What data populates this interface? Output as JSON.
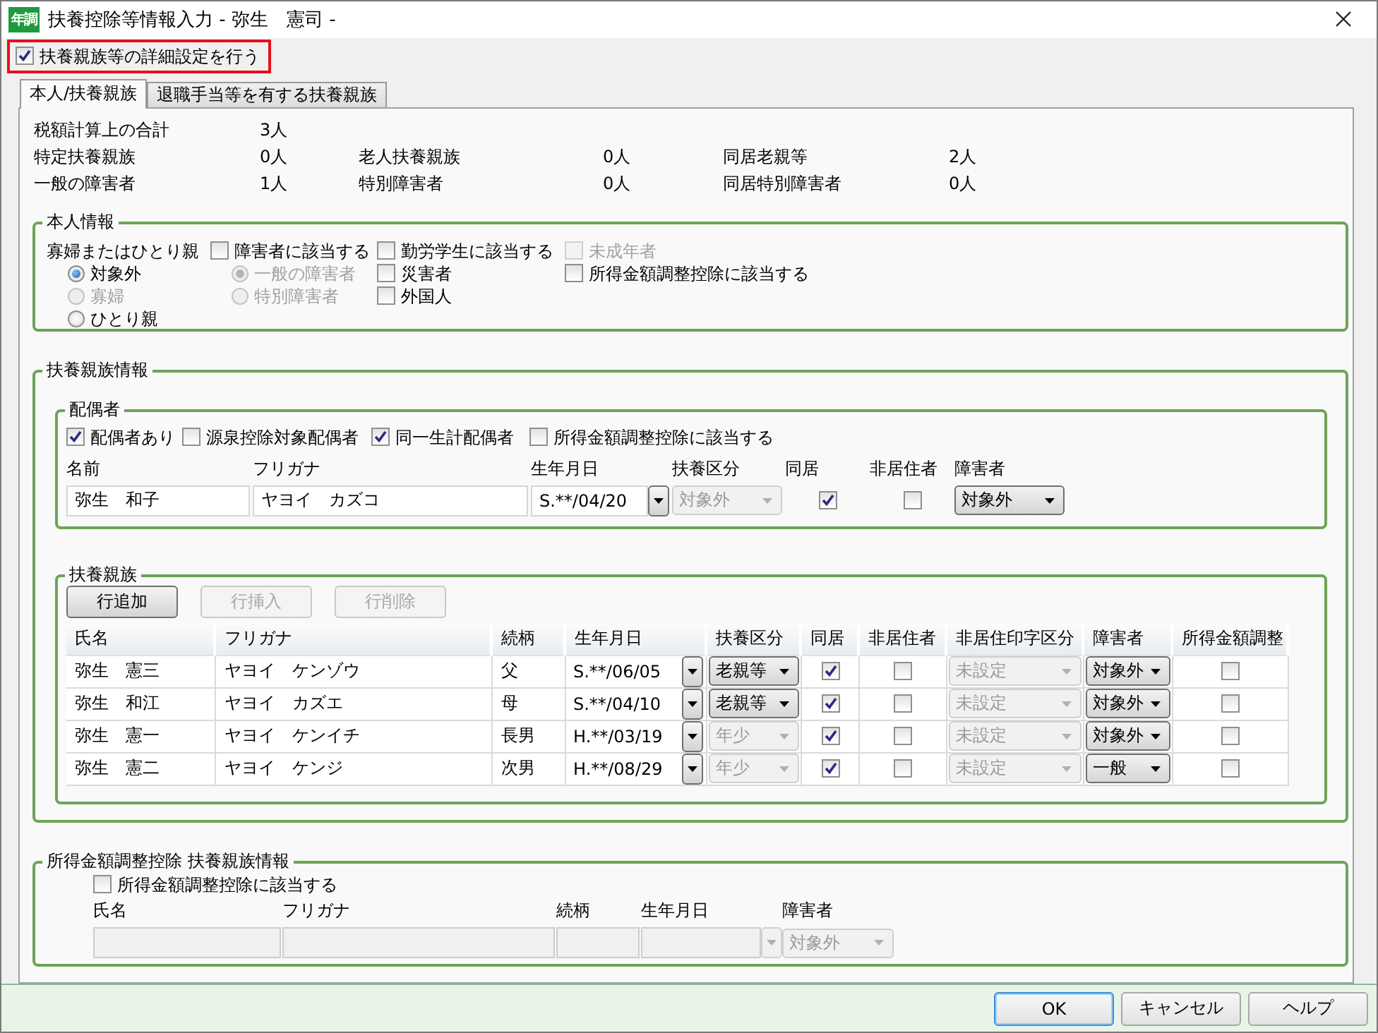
{
  "window": {
    "icon_text": "年調",
    "title": "扶養控除等情報入力 - 弥生　憲司 -"
  },
  "detail_setting": {
    "label": "扶養親族等の詳細設定を行う",
    "checked": true
  },
  "tabs": [
    {
      "label": "本人/扶養親族",
      "selected": true
    },
    {
      "label": "退職手当等を有する扶養親族",
      "selected": false
    }
  ],
  "summary": [
    [
      {
        "label": "税額計算上の合計",
        "value": "3人"
      }
    ],
    [
      {
        "label": "特定扶養親族",
        "value": "0人"
      },
      {
        "label": "老人扶養親族",
        "value": "0人"
      },
      {
        "label": "同居老親等",
        "value": "2人"
      }
    ],
    [
      {
        "label": "一般の障害者",
        "value": "1人"
      },
      {
        "label": "特別障害者",
        "value": "0人"
      },
      {
        "label": "同居特別障害者",
        "value": "0人"
      }
    ]
  ],
  "self_info": {
    "title": "本人情報",
    "widow_label": "寡婦またはひとり親",
    "widow_options": [
      {
        "label": "対象外",
        "selected": true,
        "disabled": false
      },
      {
        "label": "寡婦",
        "selected": false,
        "disabled": true
      },
      {
        "label": "ひとり親",
        "selected": false,
        "disabled": false
      }
    ],
    "disability": {
      "label": "障害者に該当する",
      "checked": false
    },
    "disability_options": [
      {
        "label": "一般の障害者",
        "selected": true,
        "disabled": true
      },
      {
        "label": "特別障害者",
        "selected": false,
        "disabled": true
      }
    ],
    "checks_col3": [
      {
        "label": "勤労学生に該当する",
        "checked": false,
        "disabled": false
      },
      {
        "label": "災害者",
        "checked": false,
        "disabled": false
      },
      {
        "label": "外国人",
        "checked": false,
        "disabled": false
      }
    ],
    "checks_col4": [
      {
        "label": "未成年者",
        "checked": false,
        "disabled": true
      },
      {
        "label": "所得金額調整控除に該当する",
        "checked": false,
        "disabled": false
      }
    ]
  },
  "dependents_info": {
    "title": "扶養親族情報",
    "spouse": {
      "title": "配偶者",
      "checks": [
        {
          "label": "配偶者あり",
          "checked": true
        },
        {
          "label": "源泉控除対象配偶者",
          "checked": false
        },
        {
          "label": "同一生計配偶者",
          "checked": true
        },
        {
          "label": "所得金額調整控除に該当する",
          "checked": false
        }
      ],
      "columns": [
        "名前",
        "フリガナ",
        "生年月日",
        "扶養区分",
        "同居",
        "非居住者",
        "障害者"
      ],
      "name": "弥生　和子",
      "kana": "ヤヨイ　カズコ",
      "birth": "S.**/04/20",
      "category": {
        "value": "対象外",
        "disabled": true
      },
      "living_together": true,
      "non_resident": false,
      "disability": {
        "value": "対象外",
        "disabled": false
      }
    },
    "family": {
      "title": "扶養親族",
      "buttons": [
        {
          "label": "行追加",
          "disabled": false
        },
        {
          "label": "行挿入",
          "disabled": true
        },
        {
          "label": "行削除",
          "disabled": true
        }
      ],
      "columns": [
        "氏名",
        "フリガナ",
        "続柄",
        "生年月日",
        "扶養区分",
        "同居",
        "非居住者",
        "非居住印字区分",
        "障害者",
        "所得金額調整"
      ],
      "rows": [
        {
          "name": "弥生　憲三",
          "kana": "ヤヨイ　ケンゾウ",
          "relation": "父",
          "birth": "S.**/06/05",
          "category": {
            "value": "老親等",
            "disabled": false
          },
          "living_together": true,
          "non_resident": false,
          "print_category": {
            "value": "未設定",
            "disabled": true
          },
          "disability": {
            "value": "対象外",
            "disabled": false
          },
          "income_adjustment": false
        },
        {
          "name": "弥生　和江",
          "kana": "ヤヨイ　カズエ",
          "relation": "母",
          "birth": "S.**/04/10",
          "category": {
            "value": "老親等",
            "disabled": false
          },
          "living_together": true,
          "non_resident": false,
          "print_category": {
            "value": "未設定",
            "disabled": true
          },
          "disability": {
            "value": "対象外",
            "disabled": false
          },
          "income_adjustment": false
        },
        {
          "name": "弥生　憲一",
          "kana": "ヤヨイ　ケンイチ",
          "relation": "長男",
          "birth": "H.**/03/19",
          "category": {
            "value": "年少",
            "disabled": true
          },
          "living_together": true,
          "non_resident": false,
          "print_category": {
            "value": "未設定",
            "disabled": true
          },
          "disability": {
            "value": "対象外",
            "disabled": false
          },
          "income_adjustment": false
        },
        {
          "name": "弥生　憲二",
          "kana": "ヤヨイ　ケンジ",
          "relation": "次男",
          "birth": "H.**/08/29",
          "category": {
            "value": "年少",
            "disabled": true
          },
          "living_together": true,
          "non_resident": false,
          "print_category": {
            "value": "未設定",
            "disabled": true
          },
          "disability": {
            "value": "一般",
            "disabled": false
          },
          "income_adjustment": false
        }
      ]
    }
  },
  "income_adjustment": {
    "title": "所得金額調整控除 扶養親族情報",
    "check": {
      "label": "所得金額調整控除に該当する",
      "checked": false
    },
    "columns": [
      "氏名",
      "フリガナ",
      "続柄",
      "生年月日",
      "障害者"
    ],
    "disability": {
      "value": "対象外",
      "disabled": true
    }
  },
  "buttons": [
    {
      "label": "OK",
      "default": true
    },
    {
      "label": "キャンセル",
      "default": false
    },
    {
      "label": "ヘルプ",
      "default": false
    }
  ]
}
